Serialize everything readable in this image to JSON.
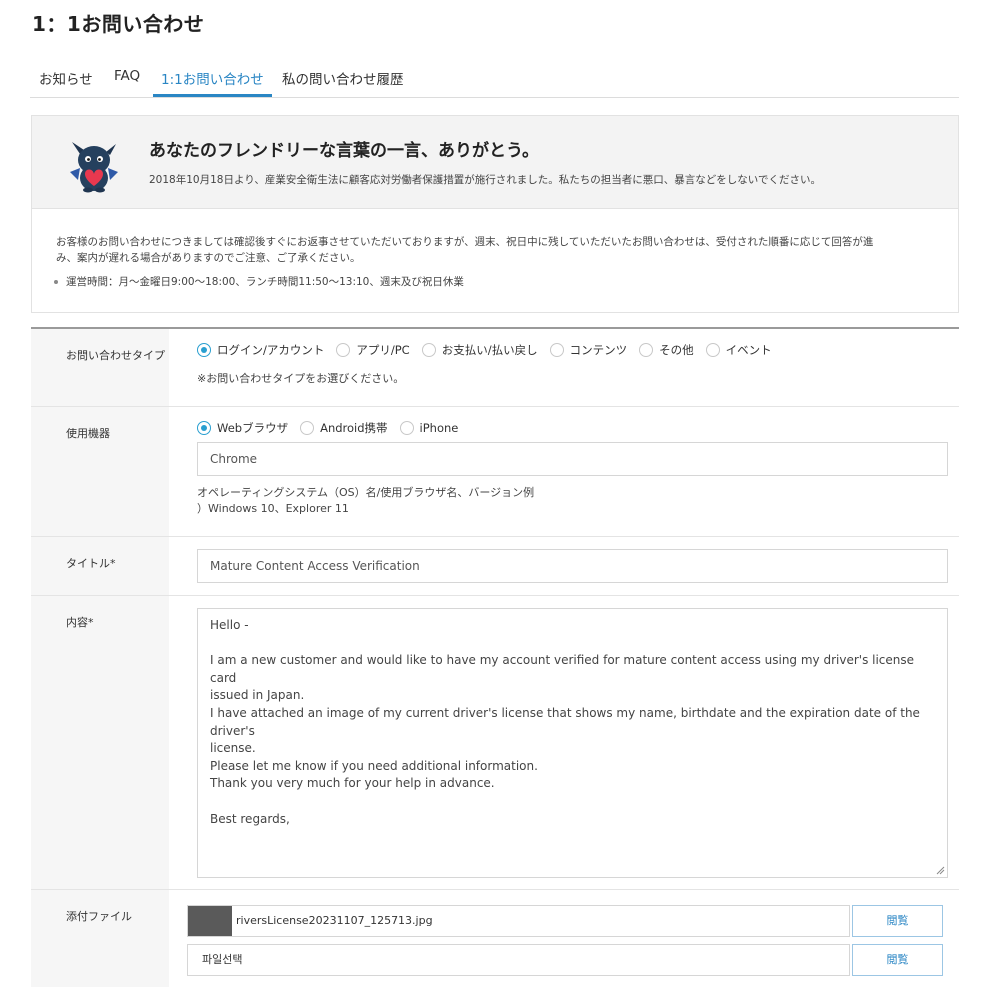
{
  "page": {
    "title": "1：1お問い合わせ"
  },
  "tabs": [
    {
      "label": "お知らせ",
      "active": false
    },
    {
      "label": "FAQ",
      "active": false
    },
    {
      "label": "1:1お問い合わせ",
      "active": true
    },
    {
      "label": "私の問い合わせ履歴",
      "active": false
    }
  ],
  "notice": {
    "heading": "あなたのフレンドリーな言葉の一言、ありがとう。",
    "subtext": "2018年10月18日より、産業安全衛生法に顧客応対労働者保護措置が施行されました。私たちの担当者に悪口、暴言などをしないでください。",
    "body_line1": "お客様のお問い合わせにつきましては確認後すぐにお返事させていただいておりますが、週末、祝日中に残していただいたお問い合わせは、受付された順番に応じて回答が進",
    "body_line2": "み、案内が遅れる場合がありますのでご注意、ご了承ください。",
    "hours": "運営時間：月〜金曜日9:00〜18:00、ランチ時間11:50〜13:10、週末及び祝日休業",
    "mascot_icon": "dragon-mascot-icon"
  },
  "form": {
    "inquiry_type": {
      "label": "お問い合わせタイプ",
      "options": [
        "ログイン/アカウント",
        "アプリ/PC",
        "お支払い/払い戻し",
        "コンテンツ",
        "その他",
        "イベント"
      ],
      "selected": "ログイン/アカウント",
      "hint": "※お問い合わせタイプをお選びください。"
    },
    "device": {
      "label": "使用機器",
      "options": [
        "Webブラウザ",
        "Android携帯",
        "iPhone"
      ],
      "selected": "Webブラウザ",
      "browser_value": "Chrome",
      "hint_line1": "オペレーティングシステム（OS）名/使用ブラウザ名、バージョン例",
      "hint_line2": "）Windows 10、Explorer 11"
    },
    "title": {
      "label": "タイトル*",
      "value": "Mature Content Access Verification"
    },
    "content": {
      "label": "内容*",
      "lines": [
        "Hello -",
        "",
        "I am a new customer and would like to have my account verified for mature content access using my driver's license card",
        "issued in Japan.",
        "I have attached an image of my current driver's license that shows my name, birthdate and the expiration date of the driver's",
        "license.",
        "Please let me know if you need additional information.",
        "Thank you very much for your help in advance.",
        "",
        "Best regards,"
      ]
    },
    "attachment": {
      "label": "添付ファイル",
      "files": [
        {
          "value": "riversLicense20231107_125713.jpg",
          "button": "閲覧"
        },
        {
          "value": "파일선택",
          "button": "閲覧"
        }
      ]
    }
  },
  "colors": {
    "accent": "#2a86c4",
    "radio_checked": "#2a9fd0",
    "label_bg": "#f6f6f6",
    "notice_bg": "#f3f3f3"
  }
}
